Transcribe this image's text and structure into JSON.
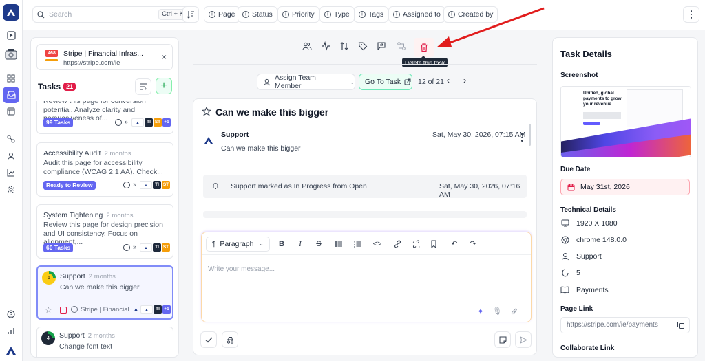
{
  "topbar": {
    "search_placeholder": "Search",
    "search_shortcut": "Ctrl + K",
    "filters": [
      "Page",
      "Status",
      "Priority",
      "Type",
      "Tags",
      "Assigned to",
      "Created by"
    ]
  },
  "site": {
    "badge": "468",
    "title": "Stripe | Financial Infras...",
    "url": "https://stripe.com/ie",
    "close": "×"
  },
  "tasks": {
    "label": "Tasks",
    "count": "21",
    "cards": [
      {
        "desc": "Review this page for conversion potential. Analyze clarity and persuasiveness of...",
        "pill": "99 Tasks",
        "more": "+1"
      },
      {
        "title": "Accessibility Audit",
        "age": "2 months",
        "desc": "Audit this page for accessibility compliance (WCAG 2.1 AA). Check...",
        "pill": "Ready to Review"
      },
      {
        "title": "System Tightening",
        "age": "2 months",
        "desc": "Review this page for design precision and UI consistency. Focus on alignment,...",
        "pill": "60 Tasks"
      },
      {
        "badge": "5",
        "title": "Support",
        "age": "2 months",
        "desc": "Can we make this bigger",
        "site": "Stripe | Financial Infi",
        "more": "+1"
      },
      {
        "badge": "4",
        "title": "Support",
        "age": "2 months",
        "desc": "Change font text"
      }
    ],
    "avatar_ti": "TI",
    "avatar_st": "ST"
  },
  "toolbar": {
    "tooltip": "Delete this task",
    "assign_label": "Assign Team Member",
    "goto_label": "Go To Task",
    "pager": "12 of 21"
  },
  "task": {
    "title": "Can we make this bigger",
    "comment": {
      "author": "Support",
      "date": "Sat, May 30, 2026, 07:15 AM",
      "body": "Can we make this bigger"
    },
    "activity": {
      "text": "Support marked as In Progress from Open",
      "date": "Sat, May 30, 2026, 07:16 AM"
    },
    "editor": {
      "block_type": "Paragraph",
      "placeholder": "Write your message..."
    }
  },
  "details": {
    "heading": "Task Details",
    "screenshot_label": "Screenshot",
    "screenshot_headline": "Unified, global payments to grow your revenue",
    "due_label": "Due Date",
    "due_value": "May 31st, 2026",
    "tech_label": "Technical Details",
    "resolution": "1920 X 1080",
    "browser": "chrome 148.0.0",
    "user": "Support",
    "number": "5",
    "category": "Payments",
    "page_link_label": "Page Link",
    "page_link": "https://stripe.com/ie/payments",
    "collab_label": "Collaborate Link"
  },
  "colors": {
    "accent": "#6366f1",
    "danger": "#e11d48",
    "success": "#16a34a",
    "annotation_arrow": "#e11d1d"
  }
}
